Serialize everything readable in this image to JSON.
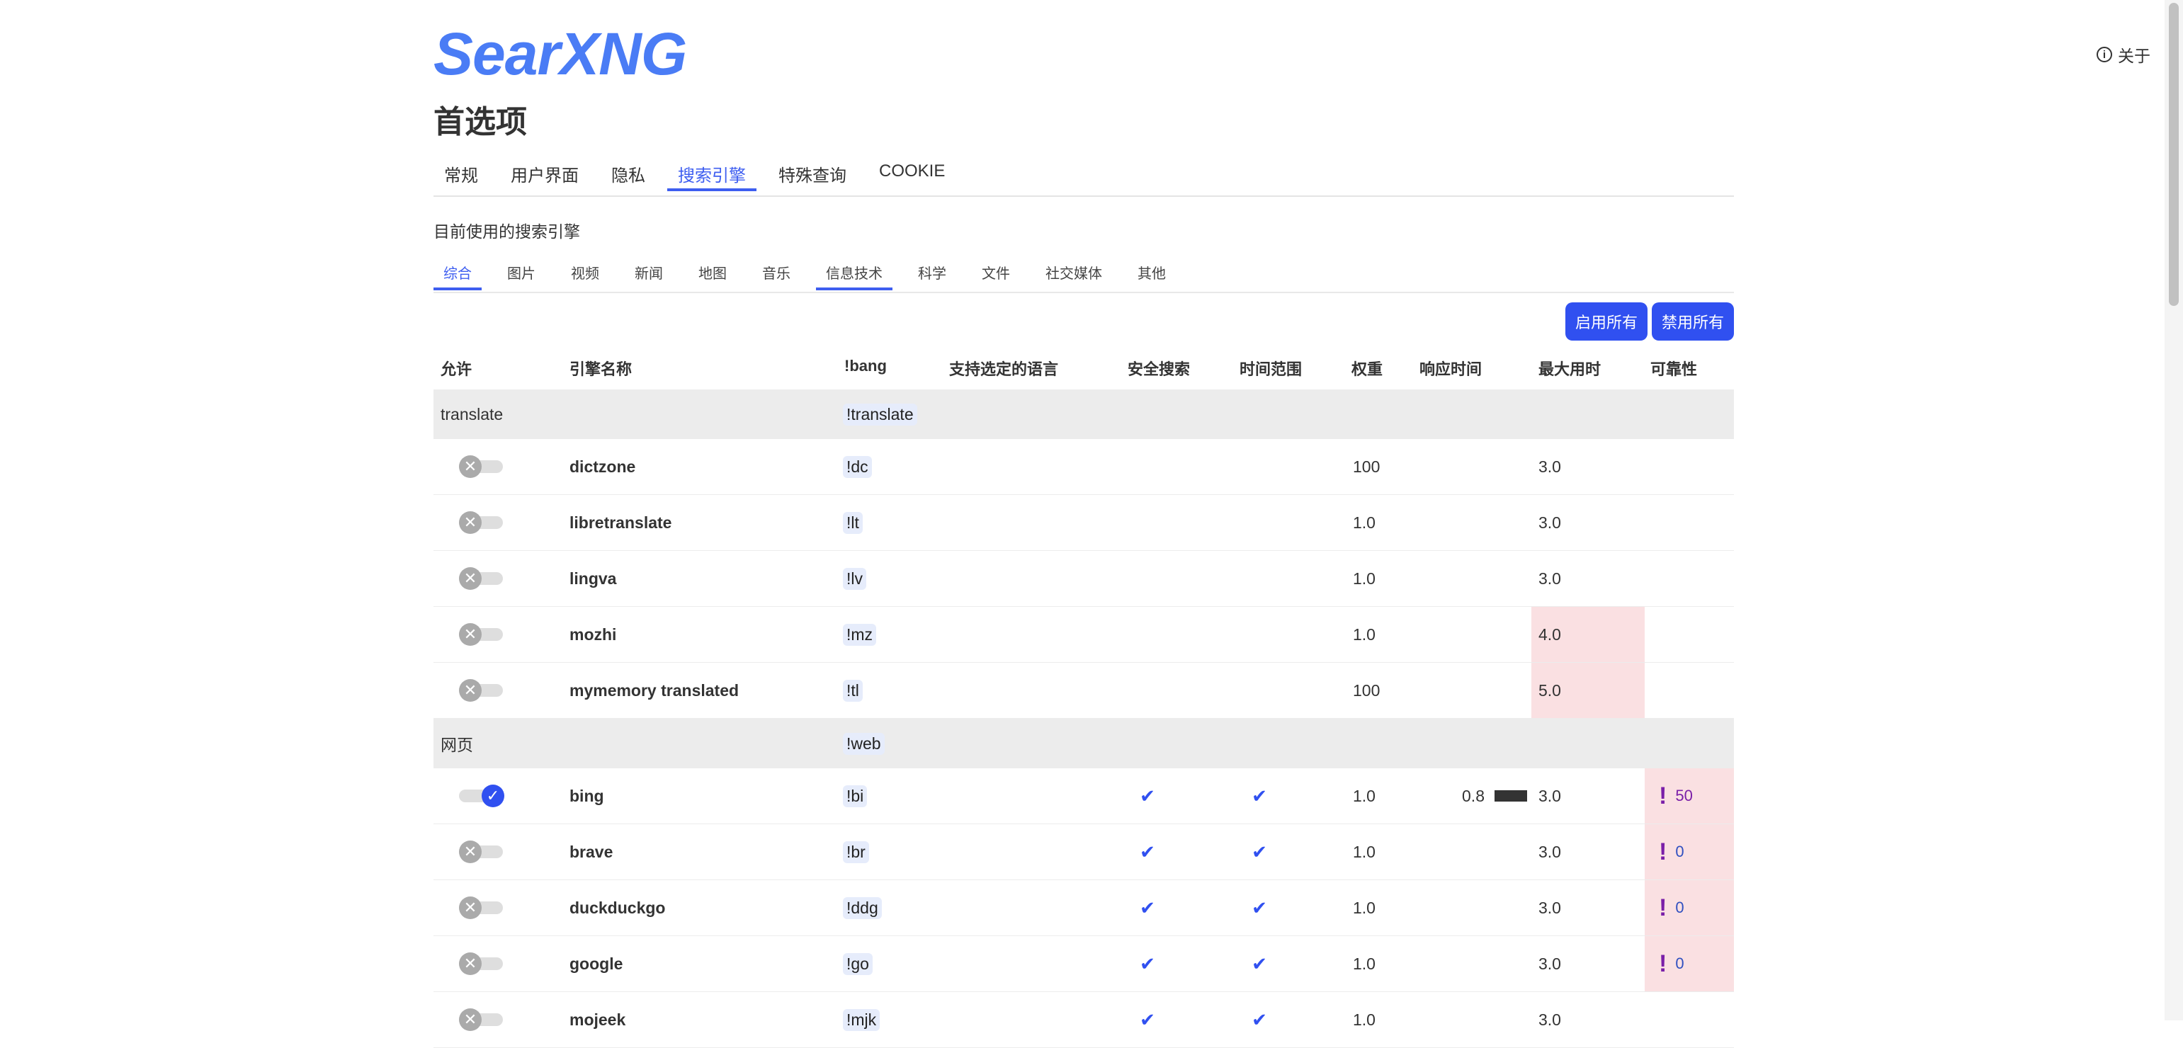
{
  "header": {
    "logo": "SearXNG",
    "title": "首选项",
    "about_label": "关于"
  },
  "tabs": [
    {
      "label": "常规",
      "active": false
    },
    {
      "label": "用户界面",
      "active": false
    },
    {
      "label": "隐私",
      "active": false
    },
    {
      "label": "搜索引擎",
      "active": true
    },
    {
      "label": "特殊查询",
      "active": false
    },
    {
      "label": "COOKIE",
      "active": false
    }
  ],
  "engines_label": "目前使用的搜索引擎",
  "subtabs": [
    {
      "label": "综合"
    },
    {
      "label": "图片"
    },
    {
      "label": "视频"
    },
    {
      "label": "新闻"
    },
    {
      "label": "地图"
    },
    {
      "label": "音乐"
    },
    {
      "label": "信息技术"
    },
    {
      "label": "科学"
    },
    {
      "label": "文件"
    },
    {
      "label": "社交媒体"
    },
    {
      "label": "其他"
    }
  ],
  "buttons": {
    "enable_all": "启用所有",
    "disable_all": "禁用所有"
  },
  "columns": {
    "allow": "允许",
    "name": "引擎名称",
    "bang": "!bang",
    "languages": "支持选定的语言",
    "safe_search": "安全搜索",
    "time_range": "时间范围",
    "weight": "权重",
    "response_time": "响应时间",
    "max_time": "最大用时",
    "reliability": "可靠性"
  },
  "colors": {
    "accent": "#3050f0",
    "logo": "#4a7cf5",
    "warn_bg": "#fae0e2",
    "reliability_mark": "#7a1fa8"
  },
  "groups": [
    {
      "name": "translate",
      "bang": "!translate",
      "engines": [
        {
          "name": "dictzone",
          "bang": "!dc",
          "enabled": false,
          "safe": false,
          "time": false,
          "weight": "100",
          "resp": "",
          "max": "3.0",
          "max_warn": false,
          "rel": "",
          "rel_warn": false
        },
        {
          "name": "libretranslate",
          "bang": "!lt",
          "enabled": false,
          "safe": false,
          "time": false,
          "weight": "1.0",
          "resp": "",
          "max": "3.0",
          "max_warn": false,
          "rel": "",
          "rel_warn": false
        },
        {
          "name": "lingva",
          "bang": "!lv",
          "enabled": false,
          "safe": false,
          "time": false,
          "weight": "1.0",
          "resp": "",
          "max": "3.0",
          "max_warn": false,
          "rel": "",
          "rel_warn": false
        },
        {
          "name": "mozhi",
          "bang": "!mz",
          "enabled": false,
          "safe": false,
          "time": false,
          "weight": "1.0",
          "resp": "",
          "max": "4.0",
          "max_warn": true,
          "rel": "",
          "rel_warn": false
        },
        {
          "name": "mymemory translated",
          "bang": "!tl",
          "enabled": false,
          "safe": false,
          "time": false,
          "weight": "100",
          "resp": "",
          "max": "5.0",
          "max_warn": true,
          "rel": "",
          "rel_warn": false
        }
      ]
    },
    {
      "name": "网页",
      "bang": "!web",
      "engines": [
        {
          "name": "bing",
          "bang": "!bi",
          "enabled": true,
          "safe": true,
          "time": true,
          "weight": "1.0",
          "resp": "0.8",
          "max": "3.0",
          "max_warn": false,
          "rel": "50",
          "rel_warn": true
        },
        {
          "name": "brave",
          "bang": "!br",
          "enabled": false,
          "safe": true,
          "time": true,
          "weight": "1.0",
          "resp": "",
          "max": "3.0",
          "max_warn": false,
          "rel": "0",
          "rel_warn": true
        },
        {
          "name": "duckduckgo",
          "bang": "!ddg",
          "enabled": false,
          "safe": true,
          "time": true,
          "weight": "1.0",
          "resp": "",
          "max": "3.0",
          "max_warn": false,
          "rel": "0",
          "rel_warn": true
        },
        {
          "name": "google",
          "bang": "!go",
          "enabled": false,
          "safe": true,
          "time": true,
          "weight": "1.0",
          "resp": "",
          "max": "3.0",
          "max_warn": false,
          "rel": "0",
          "rel_warn": true
        },
        {
          "name": "mojeek",
          "bang": "!mjk",
          "enabled": false,
          "safe": true,
          "time": true,
          "weight": "1.0",
          "resp": "",
          "max": "3.0",
          "max_warn": false,
          "rel": "",
          "rel_warn": false
        }
      ]
    }
  ]
}
